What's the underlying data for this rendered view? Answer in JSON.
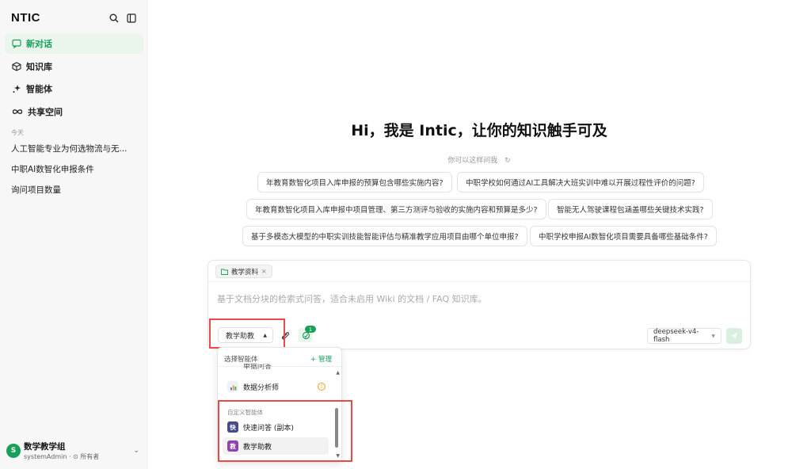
{
  "brand": {
    "logo": "NTIC",
    "logo_sub": ""
  },
  "sidebar": {
    "nav": [
      {
        "label": "新对话",
        "icon": "chat-icon",
        "active": true
      },
      {
        "label": "知识库",
        "icon": "cube-icon"
      },
      {
        "label": "智能体",
        "icon": "sparkle-icon"
      },
      {
        "label": "共享空间",
        "icon": "infinity-icon"
      }
    ],
    "section_label": "今天",
    "history": [
      "人工智能专业为何选物流与无...",
      "中职AI数智化申报条件",
      "询问项目数量"
    ],
    "user": {
      "avatar_letter": "S",
      "name": "数学教学组",
      "sub": "systemAdmin · ⊙ 所有者"
    }
  },
  "main": {
    "title": "Hi，我是 Intic，让你的知识触手可及",
    "hint": "你可以这样问我",
    "suggestions": [
      "年教育数智化项目入库申报的预算包含哪些实施内容?",
      "中职学校如何通过AI工具解决大班实训中难以开展过程性评价的问题?",
      "年教育数智化项目入库申报中项目管理、第三方测评与验收的实施内容和预算是多少?",
      "智能无人驾驶课程包涵盖哪些关键技术实践?",
      "基于多模态大模型的中职实训技能智能评估与精准教学应用项目由哪个单位申报?",
      "中职学校申报AI数智化项目需要具备哪些基础条件?"
    ],
    "input": {
      "kb_tag": "教学资料",
      "placeholder": "基于文档分块的检索式问答，适合未启用 Wiki 的文档 / FAQ 知识库。",
      "agent": "教学助教",
      "plugin_count": "1",
      "model": "deepseek-v4-flash"
    }
  },
  "dropdown": {
    "title": "选择智能体",
    "manage": "+ 管理",
    "partial_item": "单据问答",
    "builtin": [
      {
        "label": "数据分析师",
        "icon": "bar-chart-icon"
      }
    ],
    "group_label": "自定义智能体",
    "custom": [
      {
        "label": "快速问答 (副本)",
        "icon_text": "快",
        "color": "#4a4a8a"
      },
      {
        "label": "教学助教",
        "icon_text": "教",
        "color": "#8e44ad",
        "selected": true
      }
    ]
  },
  "colors": {
    "accent": "#18a058",
    "highlight": "#e74c4c"
  }
}
